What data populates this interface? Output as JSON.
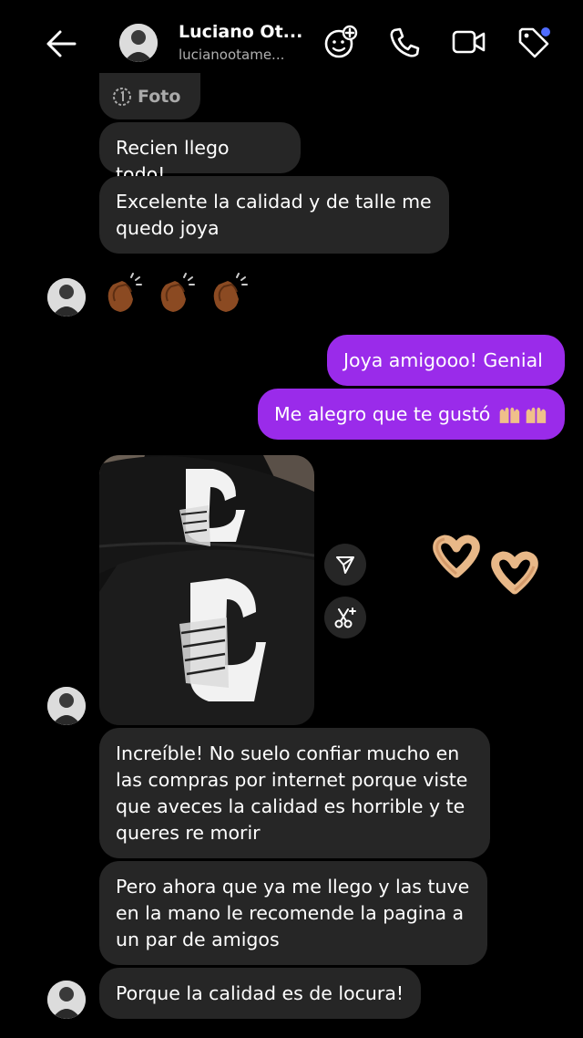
{
  "header": {
    "name": "Luciano Ot...",
    "username": "lucianootame...",
    "icons": [
      "back-arrow-icon",
      "sticker-add-icon",
      "phone-icon",
      "video-camera-icon",
      "tag-icon"
    ],
    "notification_dot_color": "#4f6cff"
  },
  "messages": {
    "foto_label": "Foto",
    "m1": "Recien llego todo!",
    "m2": "Excelente la calidad y de talle me\nquedo joya",
    "reaction_emoji": "clapping-hands x3",
    "o1": "Joya amigooo! Genial",
    "o2": "Me alegro que te gustó",
    "o2_emoji": "raised-hands x2",
    "photo_desc_icons": [
      "share-icon",
      "scissors-sparkle-icon"
    ],
    "photo_reaction": "heart-hands x2",
    "m3": "Increíble! No suelo confiar mucho en\nlas compras por internet porque viste\nque aveces la calidad es horrible y te\nqueres re morir",
    "m4": "Pero ahora que ya me llego y las tuve\nen la mano le recomende la pagina a\nun par de amigos",
    "m5": "Porque la calidad es de locura!"
  },
  "colors": {
    "background": "#000000",
    "incoming_bubble": "#262626",
    "outgoing_bubble": "#9a2bea"
  }
}
